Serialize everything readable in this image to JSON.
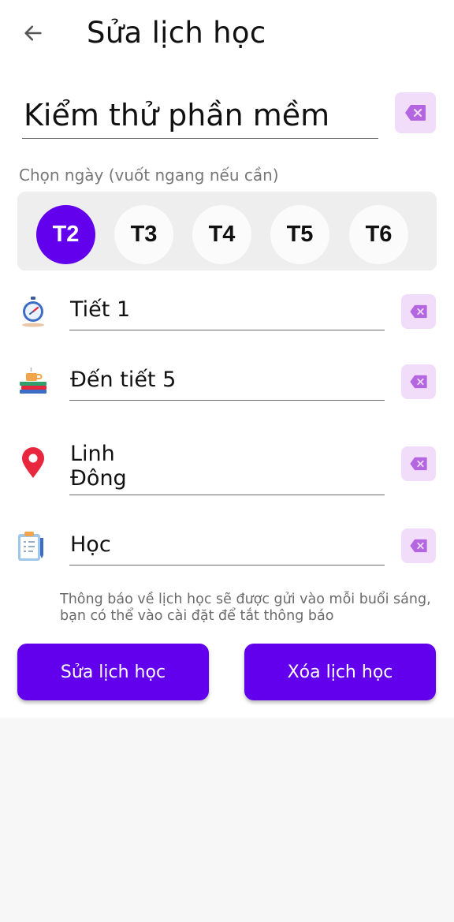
{
  "header": {
    "title": "Sửa lịch học",
    "back_icon": "arrow-left-icon"
  },
  "subject": {
    "value": "Kiểm thử phần mềm",
    "clear_icon": "backspace-icon"
  },
  "days": {
    "label": "Chọn ngày (vuốt ngang nếu cần)",
    "items": [
      "T2",
      "T3",
      "T4",
      "T5",
      "T6"
    ],
    "selected": "T2"
  },
  "fields": {
    "start_period": {
      "value": "Tiết 1",
      "icon": "stopwatch-icon"
    },
    "end_period": {
      "value": "Đến tiết 5",
      "icon": "books-coffee-icon"
    },
    "location": {
      "value": "Linh\nĐông",
      "icon": "map-pin-icon"
    },
    "note": {
      "value": "Học",
      "icon": "clipboard-icon"
    }
  },
  "notice": "Thông báo về lịch học sẽ được gửi vào mỗi buổi sáng, bạn có thể vào cài đặt để tắt thông báo",
  "actions": {
    "edit_label": "Sửa lịch học",
    "delete_label": "Xóa lịch học"
  },
  "colors": {
    "primary": "#6200ee",
    "clear_bg": "#f1dcfa",
    "clear_icon": "#b466e0",
    "pin": "#e8263e"
  }
}
